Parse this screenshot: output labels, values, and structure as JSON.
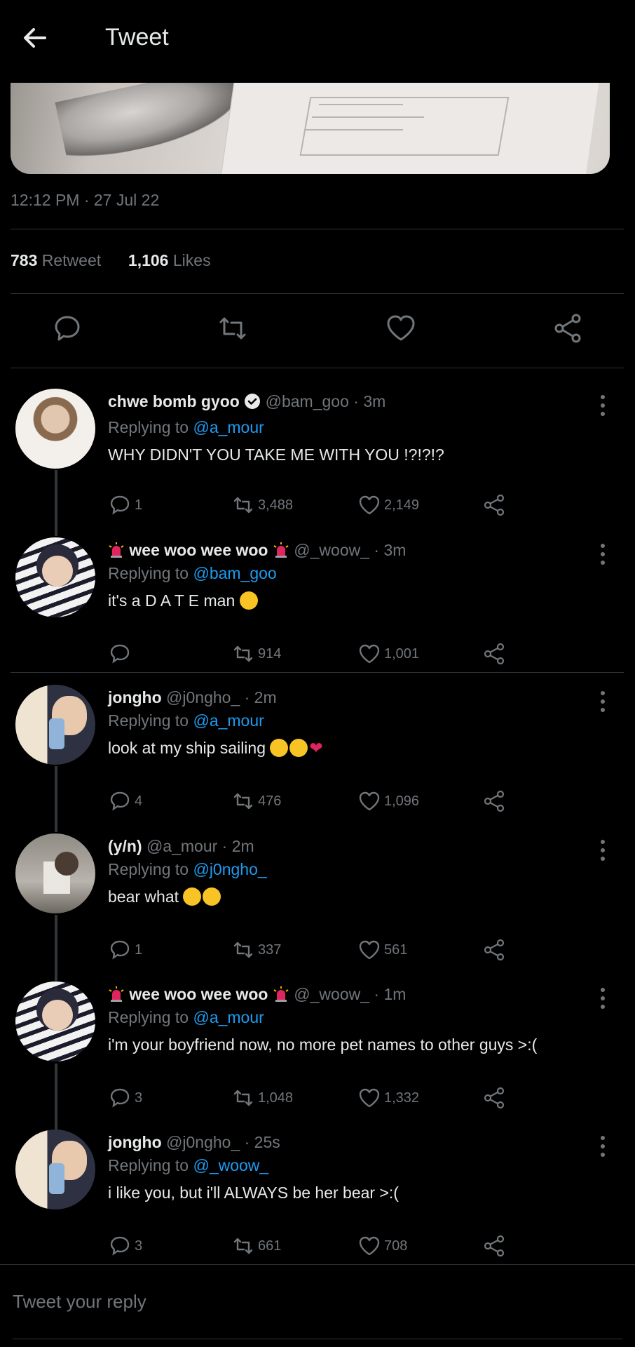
{
  "header": {
    "title": "Tweet"
  },
  "main_tweet": {
    "timestamp": "12:12 PM · 27 Jul 22",
    "retweets": "783",
    "retweets_label": "Retweet",
    "likes": "1,106",
    "likes_label": "Likes"
  },
  "replies": [
    {
      "name": "chwe bomb gyoo",
      "verified": true,
      "handle": "@bam_goo · 3m",
      "replying_prefix": "Replying to ",
      "replying_to": "@a_mour",
      "text": "WHY DIDN'T YOU TAKE ME WITH YOU !?!?!?",
      "comments": "1",
      "retweets": "3,488",
      "likes": "2,149"
    },
    {
      "name": "wee woo wee woo",
      "handle": "@_woow_ · 3m",
      "replying_prefix": "Replying to ",
      "replying_to": "@bam_goo",
      "text": "it's a D A T E man",
      "comments": "",
      "retweets": "914",
      "likes": "1,001"
    },
    {
      "name": "jongho",
      "handle": "@j0ngho_ · 2m",
      "replying_prefix": "Replying to ",
      "replying_to": "@a_mour",
      "text": "look at my ship sailing",
      "comments": "4",
      "retweets": "476",
      "likes": "1,096"
    },
    {
      "name": "(y/n)",
      "handle": "@a_mour · 2m",
      "replying_prefix": "Replying to ",
      "replying_to": "@j0ngho_",
      "text": "bear what",
      "comments": "1",
      "retweets": "337",
      "likes": "561"
    },
    {
      "name": "wee woo wee woo",
      "handle": "@_woow_ · 1m",
      "replying_prefix": "Replying to ",
      "replying_to": "@a_mour",
      "text": "i'm your boyfriend now, no more pet names to other guys >:(",
      "comments": "3",
      "retweets": "1,048",
      "likes": "1,332"
    },
    {
      "name": "jongho",
      "handle": "@j0ngho_ · 25s",
      "replying_prefix": "Replying to ",
      "replying_to": "@_woow_",
      "text": "i like you, but i'll ALWAYS be her bear >:(",
      "comments": "3",
      "retweets": "661",
      "likes": "708"
    }
  ],
  "compose": {
    "placeholder": "Tweet your reply"
  },
  "colors": {
    "background": "#000000",
    "text": "#e7e9ea",
    "muted": "#71767b",
    "link": "#1d9bf0",
    "divider": "#2f3336"
  },
  "icons": [
    "back-arrow-icon",
    "reply-icon",
    "retweet-icon",
    "heart-icon",
    "share-icon",
    "more-icon",
    "verified-icon",
    "siren-icon"
  ]
}
